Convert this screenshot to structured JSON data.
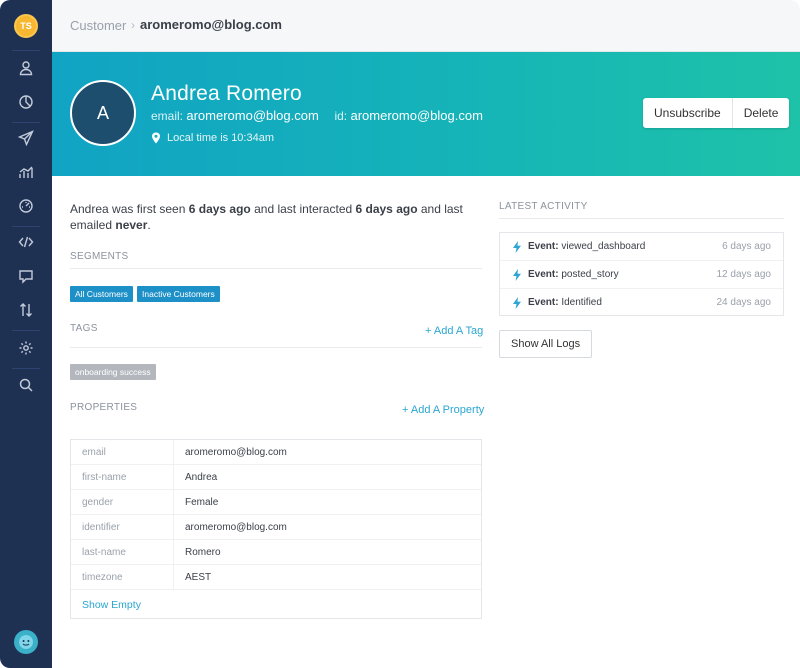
{
  "sidebar": {
    "avatar_initials": "TS",
    "icons": [
      "person-icon",
      "segments-icon",
      "send-icon",
      "analytics-icon",
      "dashboard-icon",
      "code-icon",
      "chat-icon",
      "sort-icon",
      "settings-icon",
      "search-icon"
    ]
  },
  "breadcrumb": {
    "root": "Customer",
    "separator": "›",
    "current": "aromeromo@blog.com"
  },
  "customer": {
    "avatar_initial": "A",
    "name": "Andrea Romero",
    "email_label": "email:",
    "email": "aromeromo@blog.com",
    "id_label": "id:",
    "id": "aromeromo@blog.com",
    "local_time": "Local time is 10:34am"
  },
  "actions": {
    "unsubscribe": "Unsubscribe",
    "delete": "Delete"
  },
  "summary": {
    "part1": "Andrea was first seen ",
    "first_seen": "6 days ago",
    "part2": " and last interacted ",
    "last_interacted": "6 days ago",
    "part3": " and last emailed ",
    "last_emailed": "never",
    "part4": "."
  },
  "segments": {
    "title": "SEGMENTS",
    "items": [
      "All Customers",
      "Inactive Customers"
    ]
  },
  "tags": {
    "title": "TAGS",
    "add_label": "+ Add A Tag",
    "items": [
      "onboarding success"
    ]
  },
  "properties": {
    "title": "PROPERTIES",
    "add_label": "+ Add A Property",
    "rows": [
      {
        "key": "email",
        "value": "aromeromo@blog.com"
      },
      {
        "key": "first-name",
        "value": "Andrea"
      },
      {
        "key": "gender",
        "value": "Female"
      },
      {
        "key": "identifier",
        "value": "aromeromo@blog.com"
      },
      {
        "key": "last-name",
        "value": "Romero"
      },
      {
        "key": "timezone",
        "value": "AEST"
      }
    ],
    "show_empty": "Show Empty"
  },
  "activity": {
    "title": "LATEST ACTIVITY",
    "event_label": "Event:",
    "items": [
      {
        "event": "viewed_dashboard",
        "ago": "6 days ago"
      },
      {
        "event": "posted_story",
        "ago": "12 days ago"
      },
      {
        "event": "Identified",
        "ago": "24 days ago"
      }
    ],
    "show_all_logs": "Show All Logs"
  },
  "colors": {
    "sidebar": "#1f3153",
    "banner_start": "#11a3c4",
    "banner_end": "#1ec2a8",
    "segment_chip": "#1e90c8",
    "tag_chip": "#b3b7bd",
    "link": "#2ba6d0",
    "bolt": "#2ba6d0"
  }
}
